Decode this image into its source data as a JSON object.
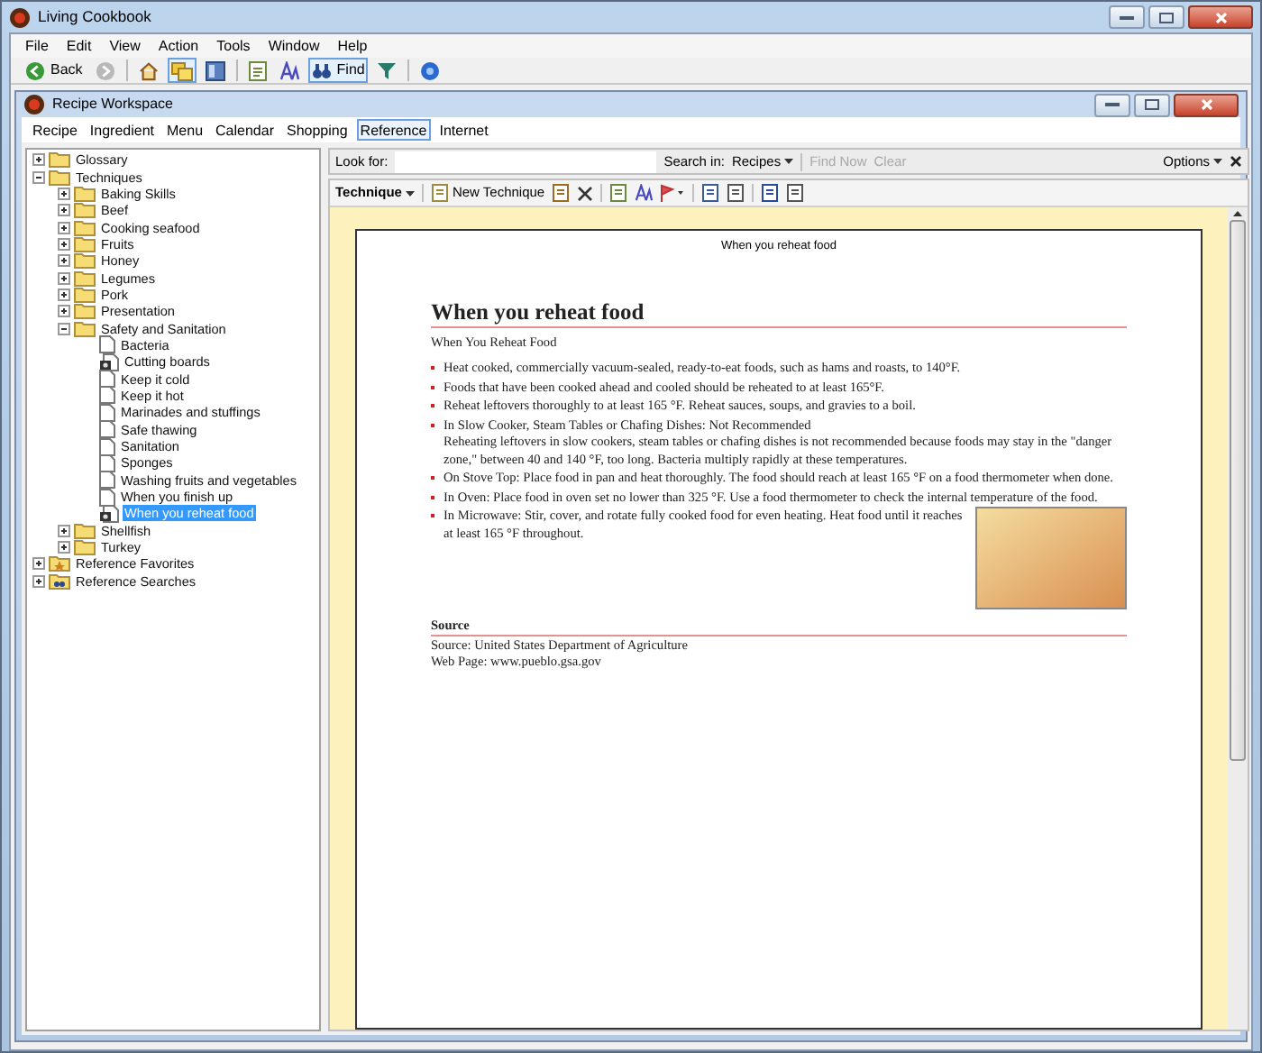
{
  "window": {
    "title": "Living Cookbook"
  },
  "menu": [
    {
      "label": "File"
    },
    {
      "label": "Edit"
    },
    {
      "label": "View"
    },
    {
      "label": "Action"
    },
    {
      "label": "Tools"
    },
    {
      "label": "Window"
    },
    {
      "label": "Help"
    }
  ],
  "toolbar": [
    {
      "kind": "back",
      "label": "Back"
    },
    {
      "kind": "forward"
    },
    {
      "kind": "sep"
    },
    {
      "kind": "home"
    },
    {
      "kind": "folders",
      "selected": true
    },
    {
      "kind": "panel",
      "selected": false
    },
    {
      "kind": "sep"
    },
    {
      "kind": "note"
    },
    {
      "kind": "font"
    },
    {
      "kind": "find",
      "label": "Find",
      "selected": true
    },
    {
      "kind": "filter"
    },
    {
      "kind": "sep"
    },
    {
      "kind": "help"
    }
  ],
  "workspace": {
    "title": "Recipe Workspace",
    "tabs": [
      {
        "label": "Recipe",
        "selected": false
      },
      {
        "label": "Ingredient",
        "selected": false
      },
      {
        "label": "Menu",
        "selected": false
      },
      {
        "label": "Calendar",
        "selected": false
      },
      {
        "label": "Shopping",
        "selected": false
      },
      {
        "label": "Reference",
        "selected": true
      },
      {
        "label": "Internet",
        "selected": false
      }
    ],
    "tree": [
      {
        "label": "Glossary",
        "kind": "folder",
        "expanded": false,
        "selected": false
      },
      {
        "label": "Techniques",
        "kind": "folder",
        "expanded": true,
        "selected": false,
        "children": [
          {
            "label": "Baking Skills",
            "kind": "folder",
            "expanded": false,
            "selected": false
          },
          {
            "label": "Beef",
            "kind": "folder",
            "expanded": false,
            "selected": false
          },
          {
            "label": "Cooking seafood",
            "kind": "folder",
            "expanded": false,
            "selected": false
          },
          {
            "label": "Fruits",
            "kind": "folder",
            "expanded": false,
            "selected": false
          },
          {
            "label": "Honey",
            "kind": "folder",
            "expanded": false,
            "selected": false
          },
          {
            "label": "Legumes",
            "kind": "folder",
            "expanded": false,
            "selected": false
          },
          {
            "label": "Pork",
            "kind": "folder",
            "expanded": false,
            "selected": false
          },
          {
            "label": "Presentation",
            "kind": "folder",
            "expanded": false,
            "selected": false
          },
          {
            "label": "Safety and Sanitation",
            "kind": "folder",
            "expanded": true,
            "selected": false,
            "children": [
              {
                "label": "Bacteria",
                "kind": "page",
                "selected": false
              },
              {
                "label": "Cutting boards",
                "kind": "image",
                "selected": false
              },
              {
                "label": "Keep it cold",
                "kind": "page",
                "selected": false
              },
              {
                "label": "Keep it hot",
                "kind": "page",
                "selected": false
              },
              {
                "label": "Marinades and stuffings",
                "kind": "page",
                "selected": false
              },
              {
                "label": "Safe thawing",
                "kind": "page",
                "selected": false
              },
              {
                "label": "Sanitation",
                "kind": "page",
                "selected": false
              },
              {
                "label": "Sponges",
                "kind": "page",
                "selected": false
              },
              {
                "label": "Washing fruits and vegetables",
                "kind": "page",
                "selected": false
              },
              {
                "label": "When you finish up",
                "kind": "page",
                "selected": false
              },
              {
                "label": "When you reheat food",
                "kind": "image",
                "selected": true
              }
            ]
          },
          {
            "label": "Shellfish",
            "kind": "folder",
            "expanded": false,
            "selected": false
          },
          {
            "label": "Turkey",
            "kind": "folder",
            "expanded": false,
            "selected": false
          }
        ]
      },
      {
        "label": "Reference Favorites",
        "kind": "favorites",
        "expanded": false,
        "selected": false
      },
      {
        "label": "Reference Searches",
        "kind": "searches",
        "expanded": false,
        "selected": false
      }
    ],
    "search": {
      "look_for_label": "Look for:",
      "search_in_label": "Search in:",
      "search_in_value": "Recipes",
      "find_now": {
        "label": "Find Now",
        "disabled": true
      },
      "clear": {
        "label": "Clear",
        "disabled": true
      },
      "options": "Options"
    },
    "doc_toolbar": {
      "type_label": "Technique",
      "new_label": "New Technique"
    },
    "document": {
      "header": "When you reheat food",
      "title": "When you reheat food",
      "subtitle": "When You Reheat Food",
      "bullets": [
        {
          "text": "Heat cooked, commercially vacuum-sealed, ready-to-eat foods, such as hams and roasts, to 140°F."
        },
        {
          "text": "Foods that have been cooked ahead and cooled should be reheated to at least 165°F."
        },
        {
          "text": "Reheat leftovers thoroughly to at least 165 °F. Reheat sauces, soups, and gravies to a boil."
        },
        {
          "text": "In Slow Cooker, Steam Tables or Chafing Dishes: Not Recommended",
          "detail": "Reheating leftovers in slow cookers, steam tables or chafing dishes is not recommended because foods may stay in the \"danger zone,\" between 40 and 140 °F, too long. Bacteria multiply rapidly at these temperatures."
        },
        {
          "text": "On Stove Top: Place food in pan and heat thoroughly. The food should reach at least 165 °F on a food thermometer when done."
        },
        {
          "text": "In Oven: Place food in oven set no lower than 325 °F. Use a food thermometer to check the internal temperature of the food."
        },
        {
          "text": "In Microwave: Stir, cover, and rotate fully cooked food for even heating. Heat food until it reaches at least 165 °F throughout."
        }
      ],
      "source_heading": "Source",
      "source_lines": [
        "Source: United States Department of Agriculture",
        "Web Page: www.pueblo.gsa.gov"
      ]
    }
  }
}
